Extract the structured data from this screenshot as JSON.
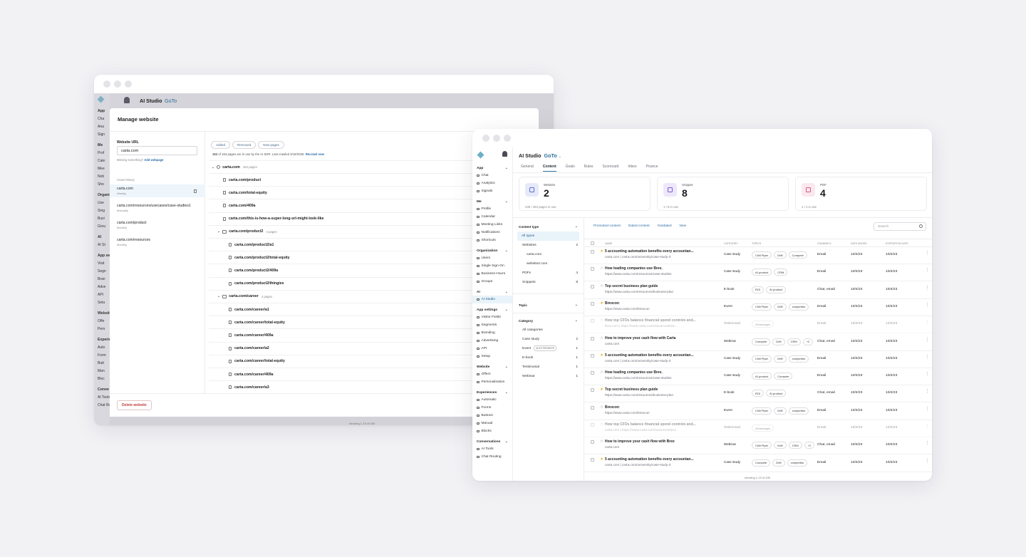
{
  "back": {
    "app_title": "AI Studio",
    "org": "GoTo",
    "sidebar": [
      {
        "type": "h",
        "label": "App"
      },
      {
        "type": "i",
        "label": "Cha"
      },
      {
        "type": "i",
        "label": "Ana"
      },
      {
        "type": "i",
        "label": "Sign"
      },
      {
        "type": "h",
        "label": "Me"
      },
      {
        "type": "i",
        "label": "Prof"
      },
      {
        "type": "i",
        "label": "Cale"
      },
      {
        "type": "i",
        "label": "Mee"
      },
      {
        "type": "i",
        "label": "Noti"
      },
      {
        "type": "i",
        "label": "Sho"
      },
      {
        "type": "h",
        "label": "Organi"
      },
      {
        "type": "i",
        "label": "Use"
      },
      {
        "type": "i",
        "label": "Sing"
      },
      {
        "type": "i",
        "label": "Busi"
      },
      {
        "type": "i",
        "label": "Grou"
      },
      {
        "type": "h",
        "label": "AI"
      },
      {
        "type": "i",
        "label": "AI St"
      },
      {
        "type": "h",
        "label": "App se"
      },
      {
        "type": "i",
        "label": "Visit"
      },
      {
        "type": "i",
        "label": "Segn"
      },
      {
        "type": "i",
        "label": "Bran"
      },
      {
        "type": "i",
        "label": "Adve"
      },
      {
        "type": "i",
        "label": "API"
      },
      {
        "type": "i",
        "label": "Setu"
      },
      {
        "type": "h",
        "label": "Websit"
      },
      {
        "type": "i",
        "label": "Offe"
      },
      {
        "type": "i",
        "label": "Pers"
      },
      {
        "type": "h",
        "label": "Experie"
      },
      {
        "type": "i",
        "label": "Auto"
      },
      {
        "type": "i",
        "label": "Form"
      },
      {
        "type": "i",
        "label": "Butt"
      },
      {
        "type": "i",
        "label": "Man"
      },
      {
        "type": "i",
        "label": "Bloc"
      },
      {
        "type": "h",
        "label": "Conve"
      },
      {
        "type": "i",
        "label": "AI Tools"
      },
      {
        "type": "i",
        "label": "Chat Routing"
      }
    ],
    "modal": {
      "title": "Manage website",
      "url_label": "Website URL",
      "url_value": "carta.com",
      "missing_text": "Missing something?",
      "add_webpage": "Add webpage",
      "crawl_history_label": "Crawl History",
      "crawls": [
        {
          "url": "carta.com",
          "freq": "Weekly"
        },
        {
          "url": "carta.com/resources/usecases/case-studies1",
          "freq": "Manually"
        },
        {
          "url": "carta.com/product",
          "freq": "Monthly"
        },
        {
          "url": "carta.com/resources",
          "freq": "Monthly"
        }
      ],
      "filters": [
        "Added",
        "Removed",
        "New pages"
      ],
      "status_count": "163",
      "status_text": "of 163 pages are in use by the AI SDR.  Last crawled 3/18/2025.",
      "recrawl": "Recrawl now",
      "root_name": "carta.com",
      "root_count": "163 pages",
      "pages": [
        {
          "k": "file",
          "indent": 1,
          "label": "carta.com/product"
        },
        {
          "k": "file",
          "indent": 1,
          "label": "carta.com/total-equity"
        },
        {
          "k": "file",
          "indent": 1,
          "label": "carta.com/409a"
        },
        {
          "k": "file",
          "indent": 1,
          "label": "carta.com/this-is-how-a-super-long-url-might-look-like"
        },
        {
          "k": "folder",
          "indent": 1,
          "label": "carta.com/product2",
          "count": "4 pages"
        },
        {
          "k": "file",
          "indent": 2,
          "label": "carta.com/product2/a1"
        },
        {
          "k": "file",
          "indent": 2,
          "label": "carta.com/product2/total-equity"
        },
        {
          "k": "file",
          "indent": 2,
          "label": "carta.com/product2/409a"
        },
        {
          "k": "file",
          "indent": 2,
          "label": "carta.com/product2/thingies"
        },
        {
          "k": "folder",
          "indent": 1,
          "label": "carta.com/career",
          "count": "4 pages"
        },
        {
          "k": "file",
          "indent": 2,
          "label": "carta.com/career/a1"
        },
        {
          "k": "file",
          "indent": 2,
          "label": "carta.com/career/total-equity"
        },
        {
          "k": "file",
          "indent": 2,
          "label": "carta.com/career/409a"
        },
        {
          "k": "file",
          "indent": 2,
          "label": "carta.com/career/a2"
        },
        {
          "k": "file",
          "indent": 2,
          "label": "carta.com/career/total-equity"
        },
        {
          "k": "file",
          "indent": 2,
          "label": "carta.com/career/409a"
        },
        {
          "k": "file",
          "indent": 2,
          "label": "carta.com/career/a3"
        }
      ],
      "delete_label": "Delete website",
      "footer": "showing 1-15 of 439"
    }
  },
  "front": {
    "app_title": "AI Studio",
    "org": "GoTo",
    "tabs": [
      "General",
      "Content",
      "Goals",
      "Rules",
      "Scorecard",
      "Inbox",
      "Pounce"
    ],
    "active_tab": "Content",
    "sidebar": [
      {
        "type": "h",
        "label": "App"
      },
      {
        "type": "i",
        "label": "Chat"
      },
      {
        "type": "i",
        "label": "Analytics"
      },
      {
        "type": "i",
        "label": "Signals"
      },
      {
        "type": "h",
        "label": "Me"
      },
      {
        "type": "i",
        "label": "Profile"
      },
      {
        "type": "i",
        "label": "Calendar"
      },
      {
        "type": "i",
        "label": "Meeting Links"
      },
      {
        "type": "i",
        "label": "Notifications"
      },
      {
        "type": "i",
        "label": "Shortcuts"
      },
      {
        "type": "h",
        "label": "Organization"
      },
      {
        "type": "i",
        "label": "Users"
      },
      {
        "type": "i",
        "label": "Single Sign-On"
      },
      {
        "type": "i",
        "label": "Business Hours"
      },
      {
        "type": "i",
        "label": "Groups"
      },
      {
        "type": "h",
        "label": "AI"
      },
      {
        "type": "i",
        "label": "AI Studio",
        "active": true
      },
      {
        "type": "h",
        "label": "App settings"
      },
      {
        "type": "i",
        "label": "Visitor Fields"
      },
      {
        "type": "i",
        "label": "Segments"
      },
      {
        "type": "i",
        "label": "Branding"
      },
      {
        "type": "i",
        "label": "Advertising"
      },
      {
        "type": "i",
        "label": "API"
      },
      {
        "type": "i",
        "label": "Setup"
      },
      {
        "type": "h",
        "label": "Website"
      },
      {
        "type": "i",
        "label": "Offers"
      },
      {
        "type": "i",
        "label": "Personalization"
      },
      {
        "type": "h",
        "label": "Experiences"
      },
      {
        "type": "i",
        "label": "Automatic"
      },
      {
        "type": "i",
        "label": "Forms"
      },
      {
        "type": "i",
        "label": "Buttons"
      },
      {
        "type": "i",
        "label": "Manual"
      },
      {
        "type": "i",
        "label": "Blocks"
      },
      {
        "type": "h",
        "label": "Conversations"
      },
      {
        "type": "i",
        "label": "AI Tools"
      },
      {
        "type": "i",
        "label": "Chat Routing"
      }
    ],
    "cards": [
      {
        "label": "Website",
        "value": "2",
        "usage": "439 / 463 pages in use",
        "color": "#e6eaf8",
        "icon": "#5b6fd1"
      },
      {
        "label": "Snippet",
        "value": "8",
        "usage": "1 / 8 in use",
        "color": "#ede7f9",
        "icon": "#7a5bd1"
      },
      {
        "label": "PDF",
        "value": "4",
        "usage": "1 / 4 in use",
        "color": "#fbe8ef",
        "icon": "#d15b85"
      }
    ],
    "filters": {
      "content_type_label": "Content type",
      "content_types": [
        {
          "label": "All types",
          "count": "",
          "active": true
        },
        {
          "label": "Websites",
          "count": "2"
        },
        {
          "label": "carta.com",
          "count": "",
          "sub": true
        },
        {
          "label": "website2.com",
          "count": "",
          "sub": true
        },
        {
          "label": "PDFs",
          "count": "4"
        },
        {
          "label": "Snippets",
          "count": "8"
        }
      ],
      "topic_label": "Topic",
      "category_label": "Category",
      "categories": [
        {
          "label": "All categories",
          "count": ""
        },
        {
          "label": "Case study",
          "count": "2"
        },
        {
          "label": "Event",
          "count": "1",
          "badge": "AUTO PROMOTE"
        },
        {
          "label": "E-book",
          "count": "1"
        },
        {
          "label": "Testimonial",
          "count": "1"
        },
        {
          "label": "Webinar",
          "count": "1"
        }
      ]
    },
    "content_filters": [
      "Promoted content",
      "Dated content",
      "Outdated",
      "New"
    ],
    "search_placeholder": "Search",
    "columns": [
      "NAME",
      "CATEGORY",
      "TOPICS",
      "CHANNELS",
      "DATE ADDED",
      "EXPIRATION DATE"
    ],
    "rows": [
      {
        "star": true,
        "name": "5 accounting automation benefits every accountan...",
        "sub": "carta.com  |  carta.com/university/case-study-3",
        "cat": "Case study",
        "topics": [
          "Chili Piper",
          "Drift",
          "Compete"
        ],
        "ch": "Email",
        "added": "10/4/23",
        "exp": "10/4/23",
        "faded": false
      },
      {
        "star": false,
        "name": "How leading companies use Brex.",
        "sub": "https://www.carta.com/resources/case-studies",
        "cat": "Case study",
        "topics": [
          "AI product",
          "CRM"
        ],
        "ch": "Email",
        "added": "10/4/23",
        "exp": "10/4/23",
        "faded": false
      },
      {
        "star": false,
        "name": "Top secret business plan guide",
        "sub": "https://www.carta.com/resources/business-plan",
        "cat": "E-book",
        "topics": [
          "ROI",
          "AI product"
        ],
        "ch": "Chat, email",
        "added": "10/4/23",
        "exp": "10/4/23",
        "faded": false
      },
      {
        "star": true,
        "name": "Brexcon",
        "sub": "https://www.carta.com/brexcon",
        "cat": "Event",
        "topics": [
          "Chili Piper",
          "Drift",
          "competitor"
        ],
        "ch": "Email",
        "added": "10/4/23",
        "exp": "10/4/23",
        "faded": false
      },
      {
        "star": false,
        "name": "How top CFOs balance financial spend controls and...",
        "sub": "brex.com  |  https://www.carta.com/resources/test...",
        "cat": "Testimonial",
        "topics": [
          "Advantages"
        ],
        "ch": "Email",
        "added": "10/4/23",
        "exp": "10/4/23",
        "faded": true
      },
      {
        "star": false,
        "name": "How to improve your cash flow with Carta",
        "sub": "carta.com",
        "cat": "Webinar",
        "topics": [
          "Compete",
          "Drift",
          "CRM",
          "+2"
        ],
        "ch": "Chat, email",
        "added": "10/4/23",
        "exp": "10/4/23",
        "faded": false
      },
      {
        "star": true,
        "name": "5 accounting automation benefits every accountan...",
        "sub": "carta.com  |  carta.com/university/case-study-3",
        "cat": "Case study",
        "topics": [
          "Chili Piper",
          "Drift",
          "competitor"
        ],
        "ch": "Email",
        "added": "10/4/23",
        "exp": "10/4/23",
        "faded": false
      },
      {
        "star": false,
        "name": "How leading companies use Brex.",
        "sub": "https://www.carta.com/resources/case-studies",
        "cat": "Case study",
        "topics": [
          "AI product",
          "Compete"
        ],
        "ch": "Email",
        "added": "10/4/23",
        "exp": "10/4/23",
        "faded": false
      },
      {
        "star": true,
        "name": "Top secret business plan guide",
        "sub": "https://www.carta.com/resources/business-plan",
        "cat": "E-book",
        "topics": [
          "ROI",
          "AI product"
        ],
        "ch": "Chat, email",
        "added": "10/4/23",
        "exp": "10/4/23",
        "faded": false
      },
      {
        "star": false,
        "name": "Brexcon",
        "sub": "https://www.carta.com/brexcon",
        "cat": "Event",
        "topics": [
          "Chili Piper",
          "Drift",
          "competitor"
        ],
        "ch": "Email",
        "added": "10/4/23",
        "exp": "10/4/23",
        "faded": false
      },
      {
        "star": false,
        "name": "How top CFOs balance financial spend controls and...",
        "sub": "carta.com  |  https://www.carta.com/resources/test...",
        "cat": "Testimonial",
        "topics": [
          "Advantages"
        ],
        "ch": "Email",
        "added": "10/4/23",
        "exp": "10/4/23",
        "faded": true
      },
      {
        "star": false,
        "name": "How to improve your cash flow with Brex",
        "sub": "carta.com",
        "cat": "Webinar",
        "topics": [
          "Chili Piper",
          "Drift",
          "CRM",
          "+2"
        ],
        "ch": "Chat, email",
        "added": "10/4/23",
        "exp": "10/4/23",
        "faded": false
      },
      {
        "star": true,
        "name": "5 accounting automation benefits every accountan...",
        "sub": "carta.com  |  carta.com/university/case-study-3",
        "cat": "Case study",
        "topics": [
          "Compete",
          "Drift",
          "competitor"
        ],
        "ch": "Email",
        "added": "10/4/23",
        "exp": "10/4/23",
        "faded": false
      }
    ],
    "footer": "showing 1-15 of 439",
    "colors": {
      "accent": "#2a6f99",
      "star": "#f0b429"
    }
  }
}
